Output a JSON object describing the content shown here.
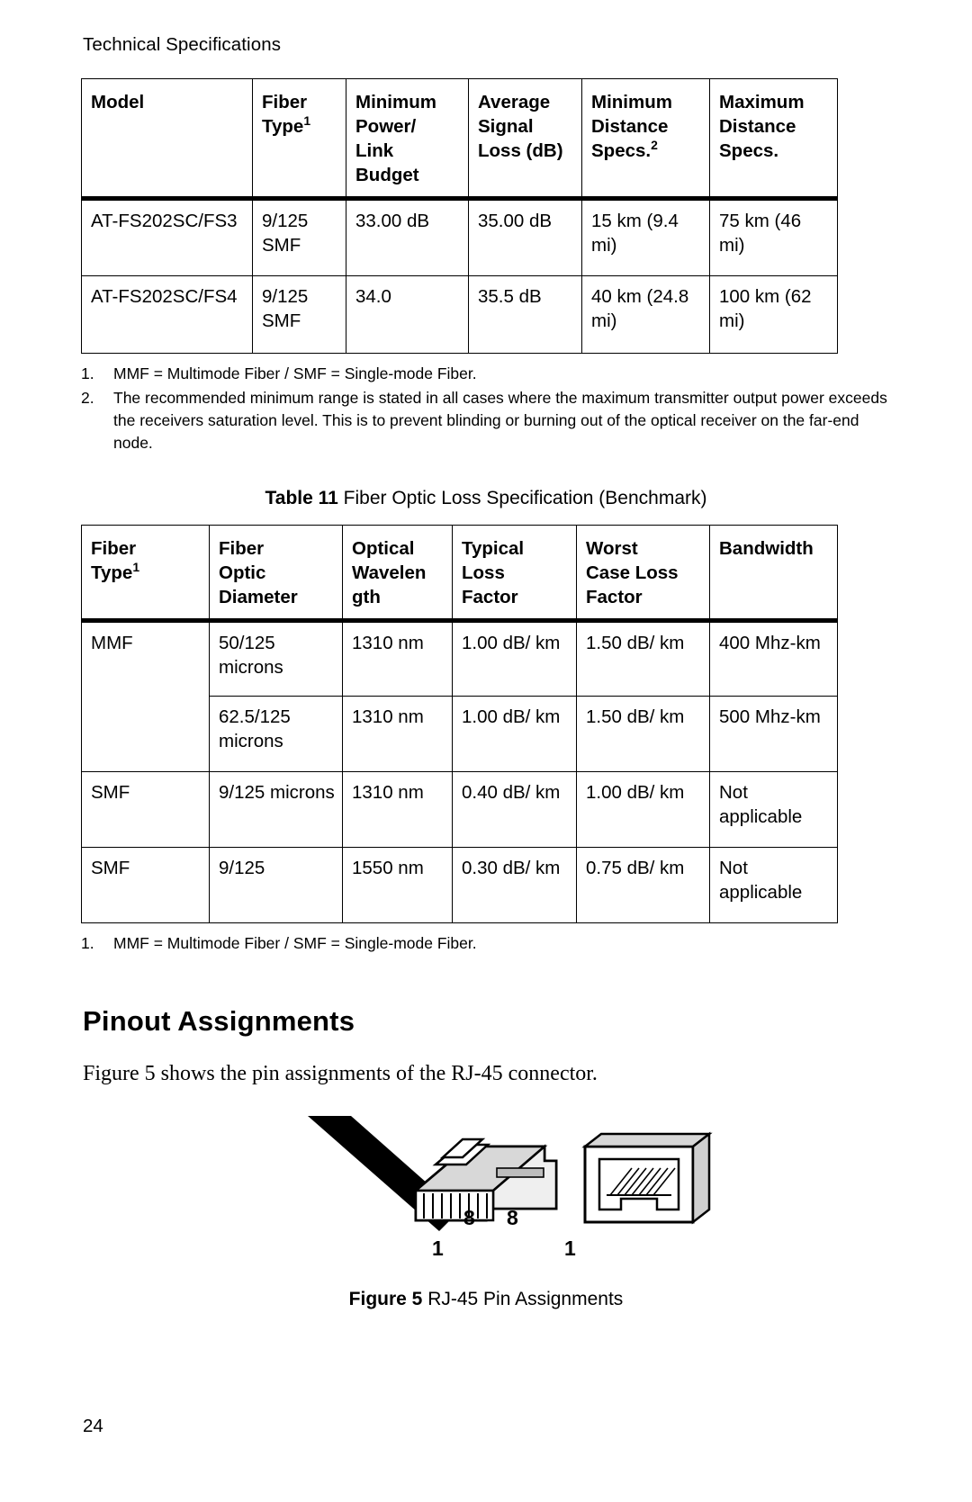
{
  "running_head": "Technical Specifications",
  "table_fiber_specs": {
    "headers": [
      {
        "lines": [
          "Model"
        ]
      },
      {
        "lines": [
          "Fiber",
          "Type"
        ],
        "sup": "1"
      },
      {
        "lines": [
          "Minimum",
          "Power/",
          "Link",
          "Budget"
        ]
      },
      {
        "lines": [
          "Average",
          "Signal",
          "Loss (dB)"
        ]
      },
      {
        "lines": [
          "Minimum",
          "Distance",
          "Specs."
        ],
        "sup": "2"
      },
      {
        "lines": [
          "Maximum",
          "Distance",
          "Specs."
        ]
      }
    ],
    "rows": [
      [
        "AT-FS202SC/FS3",
        "9/125 SMF",
        "33.00 dB",
        "35.00 dB",
        "15 km (9.4 mi)",
        "75 km (46 mi)"
      ],
      [
        "AT-FS202SC/FS4",
        "9/125 SMF",
        "34.0",
        "35.5 dB",
        "40 km (24.8 mi)",
        "100 km (62 mi)"
      ]
    ],
    "footnotes": [
      {
        "num": "1.",
        "text": "MMF = Multimode Fiber / SMF = Single-mode Fiber."
      },
      {
        "num": "2.",
        "text": "The recommended minimum range is stated in all cases where the maximum transmitter output power exceeds the receivers saturation level. This is to prevent blinding or burning out of the optical receiver on the far-end node."
      }
    ]
  },
  "table11": {
    "caption_label": "Table 11",
    "caption_text": "Fiber Optic Loss Specification (Benchmark)",
    "headers": [
      {
        "lines": [
          "Fiber",
          "Type"
        ],
        "sup": "1"
      },
      {
        "lines": [
          "Fiber",
          "Optic",
          "Diameter"
        ]
      },
      {
        "lines": [
          "Optical",
          "Wavelen",
          "gth"
        ]
      },
      {
        "lines": [
          "Typical",
          "Loss",
          "Factor"
        ]
      },
      {
        "lines": [
          "Worst",
          "Case Loss",
          "Factor"
        ]
      },
      {
        "lines": [
          "Bandwidth"
        ]
      }
    ],
    "rows": [
      {
        "fiber_type": "MMF",
        "rowspan": 2,
        "diameter": "50/125 microns",
        "wavelength": "1310 nm",
        "typical_loss": "1.00 dB/ km",
        "worst_case_loss": "1.50 dB/ km",
        "bandwidth": "400 Mhz-km"
      },
      {
        "fiber_type": "",
        "continued": true,
        "diameter": "62.5/125 microns",
        "wavelength": "1310 nm",
        "typical_loss": "1.00 dB/ km",
        "worst_case_loss": "1.50 dB/ km",
        "bandwidth": "500 Mhz-km"
      },
      {
        "fiber_type": "SMF",
        "diameter": "9/125 microns",
        "wavelength": "1310 nm",
        "typical_loss": "0.40 dB/ km",
        "worst_case_loss": "1.00 dB/ km",
        "bandwidth": "Not applicable"
      },
      {
        "fiber_type": "SMF",
        "diameter": "9/125",
        "wavelength": "1550 nm",
        "typical_loss": "0.30 dB/ km",
        "worst_case_loss": "0.75 dB/ km",
        "bandwidth": "Not applicable"
      }
    ],
    "footnotes": [
      {
        "num": "1.",
        "text": "MMF = Multimode Fiber / SMF = Single-mode Fiber."
      }
    ]
  },
  "pinout": {
    "heading": "Pinout Assignments",
    "intro": "Figure 5 shows the pin assignments of the RJ-45 connector.",
    "plug_label_top": "8",
    "plug_label_bottom": "1",
    "jack_label_top": "8",
    "jack_label_bottom": "1",
    "figure_caption_label": "Figure 5",
    "figure_caption_text": "RJ-45 Pin Assignments"
  },
  "page_number": "24"
}
